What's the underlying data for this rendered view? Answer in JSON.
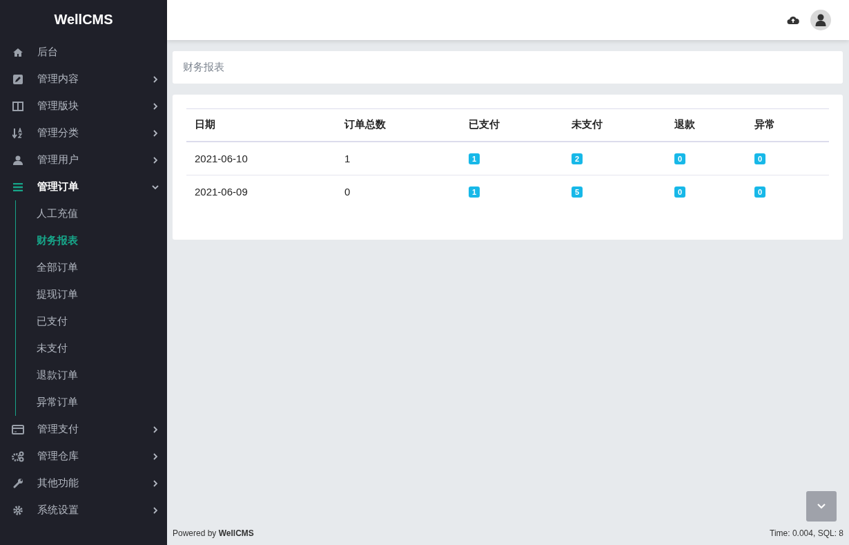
{
  "sidebar": {
    "brand": "WellCMS",
    "items": [
      {
        "label": "后台",
        "kind": "link"
      },
      {
        "label": "管理内容",
        "kind": "group",
        "expanded": false
      },
      {
        "label": "管理版块",
        "kind": "group",
        "expanded": false
      },
      {
        "label": "管理分类",
        "kind": "group",
        "expanded": false
      },
      {
        "label": "管理用户",
        "kind": "group",
        "expanded": false
      },
      {
        "label": "管理订单",
        "kind": "group",
        "expanded": true,
        "children": [
          {
            "label": "人工充值",
            "selected": false
          },
          {
            "label": "财务报表",
            "selected": true
          },
          {
            "label": "全部订单",
            "selected": false
          },
          {
            "label": "提现订单",
            "selected": false
          },
          {
            "label": "已支付",
            "selected": false
          },
          {
            "label": "未支付",
            "selected": false
          },
          {
            "label": "退款订单",
            "selected": false
          },
          {
            "label": "异常订单",
            "selected": false
          }
        ]
      },
      {
        "label": "管理支付",
        "kind": "group",
        "expanded": false
      },
      {
        "label": "管理仓库",
        "kind": "group",
        "expanded": false
      },
      {
        "label": "其他功能",
        "kind": "group",
        "expanded": false
      },
      {
        "label": "系统设置",
        "kind": "group",
        "expanded": false
      }
    ]
  },
  "breadcrumb": "财务报表",
  "table": {
    "columns": [
      "日期",
      "订单总数",
      "已支付",
      "未支付",
      "退款",
      "异常"
    ],
    "rows": [
      {
        "cells": [
          "2021-06-10",
          "1"
        ],
        "badges": [
          "1",
          "2",
          "0",
          "0"
        ]
      },
      {
        "cells": [
          "2021-06-09",
          "0"
        ],
        "badges": [
          "1",
          "5",
          "0",
          "0"
        ]
      }
    ]
  },
  "footer": {
    "powered": "Powered by **WellCMS**",
    "stats": "Time: 0.004, SQL: 8"
  }
}
